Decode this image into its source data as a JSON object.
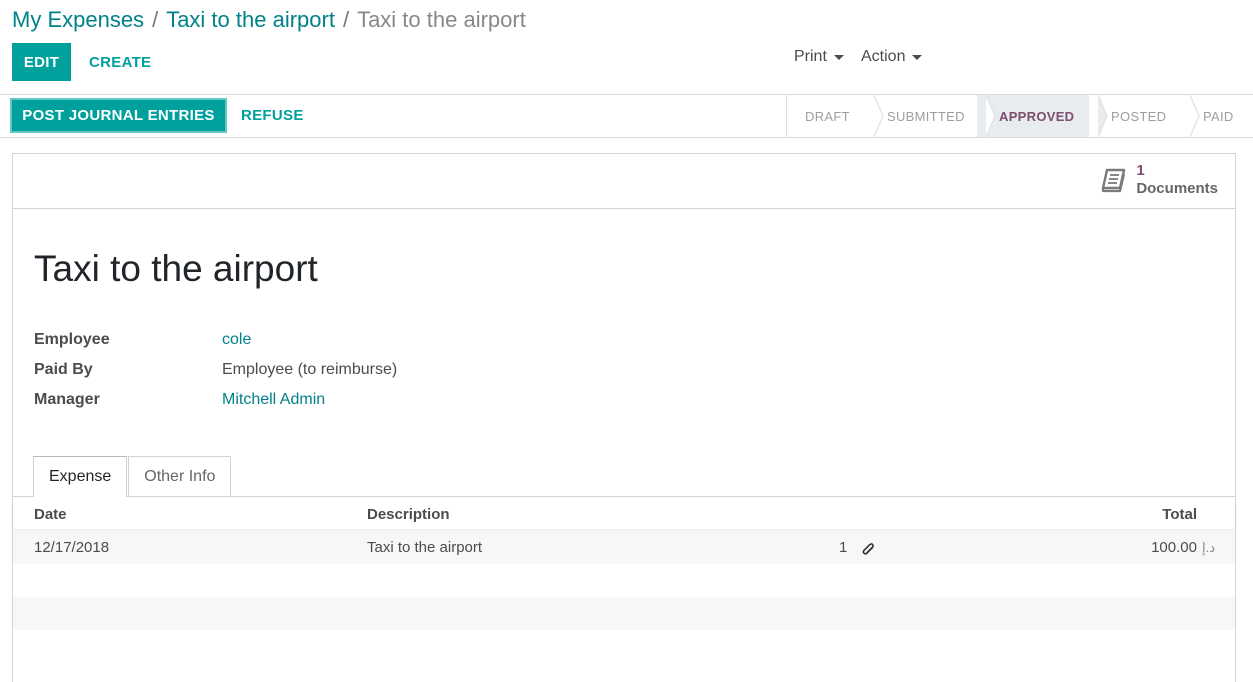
{
  "breadcrumb": {
    "items": [
      "My Expenses",
      "Taxi to the airport"
    ],
    "current": "Taxi to the airport",
    "separator": "/"
  },
  "toolbar": {
    "edit_label": "EDIT",
    "create_label": "CREATE",
    "print_label": "Print",
    "action_label": "Action"
  },
  "statusbar": {
    "post_label": "POST JOURNAL ENTRIES",
    "refuse_label": "REFUSE",
    "stages": [
      "DRAFT",
      "SUBMITTED",
      "APPROVED",
      "POSTED",
      "PAID"
    ],
    "active_stage": "APPROVED"
  },
  "smart_button": {
    "count": "1",
    "label": "Documents",
    "icon": "book-icon"
  },
  "record": {
    "title": "Taxi to the airport",
    "fields": [
      {
        "label": "Employee",
        "value": "cole",
        "link": true
      },
      {
        "label": "Paid By",
        "value": "Employee (to reimburse)",
        "link": false
      },
      {
        "label": "Manager",
        "value": "Mitchell Admin",
        "link": true
      }
    ]
  },
  "tabs": [
    "Expense",
    "Other Info"
  ],
  "table": {
    "headers": {
      "date": "Date",
      "description": "Description",
      "total": "Total"
    },
    "rows": [
      {
        "date": "12/17/2018",
        "description": "Taxi to the airport",
        "attachments": "1",
        "total": "100.00",
        "currency": "د.إ"
      }
    ]
  },
  "colors": {
    "primary": "#00a09d",
    "link": "#00828a",
    "active_stage": "#7c4d6e"
  }
}
